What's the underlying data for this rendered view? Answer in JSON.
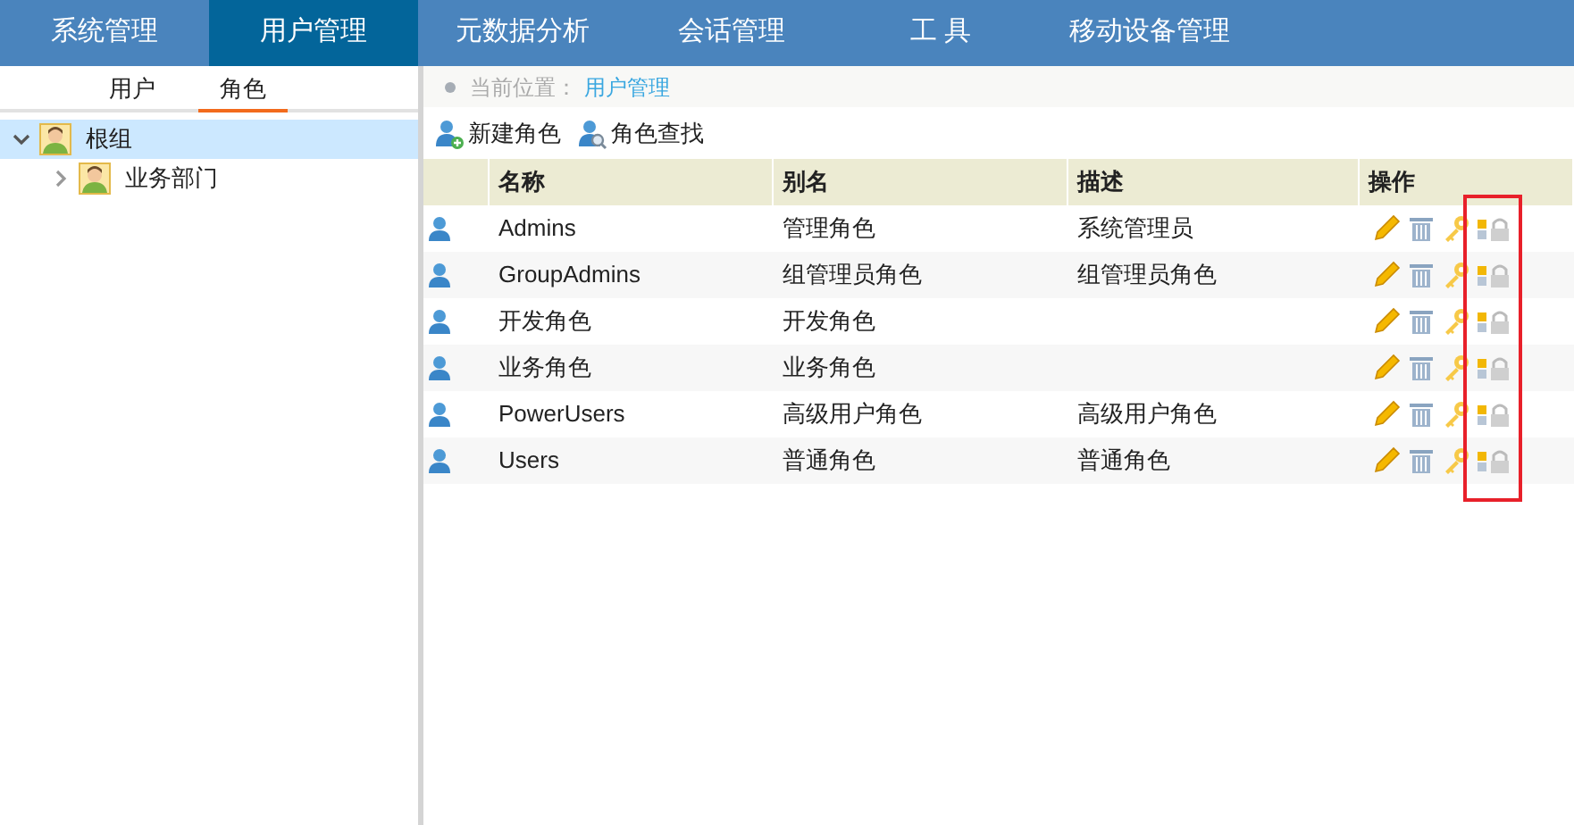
{
  "nav": [
    {
      "label": "系统管理",
      "selected": false
    },
    {
      "label": "用户管理",
      "selected": true
    },
    {
      "label": "元数据分析",
      "selected": false
    },
    {
      "label": "会话管理",
      "selected": false
    },
    {
      "label": "工 具",
      "selected": false
    },
    {
      "label": "移动设备管理",
      "selected": false
    }
  ],
  "side_tabs": [
    {
      "label": "用户",
      "selected": false
    },
    {
      "label": "角色",
      "selected": true
    }
  ],
  "tree": [
    {
      "label": "根组",
      "expanded": true,
      "selected": true,
      "children": [
        {
          "label": "业务部门",
          "expanded": false,
          "selected": false
        }
      ]
    }
  ],
  "breadcrumb": {
    "label": "当前位置：",
    "value": "用户管理"
  },
  "toolbar": [
    {
      "kind": "new",
      "label": "新建角色"
    },
    {
      "kind": "find",
      "label": "角色查找"
    }
  ],
  "table": {
    "columns": [
      "名称",
      "别名",
      "描述",
      "操作"
    ],
    "rows": [
      {
        "name": "Admins",
        "alias": "管理角色",
        "description": "系统管理员"
      },
      {
        "name": "GroupAdmins",
        "alias": "组管理员角色",
        "description": "组管理员角色"
      },
      {
        "name": "开发角色",
        "alias": "开发角色"
      },
      {
        "name": "业务角色",
        "alias": "业务角色"
      },
      {
        "name": "PowerUsers",
        "alias": "高级用户角色",
        "description": "高级用户角色"
      },
      {
        "name": "Users",
        "alias": "普通角色",
        "description": "普通角色"
      }
    ]
  },
  "highlight": {
    "kind": "box"
  }
}
